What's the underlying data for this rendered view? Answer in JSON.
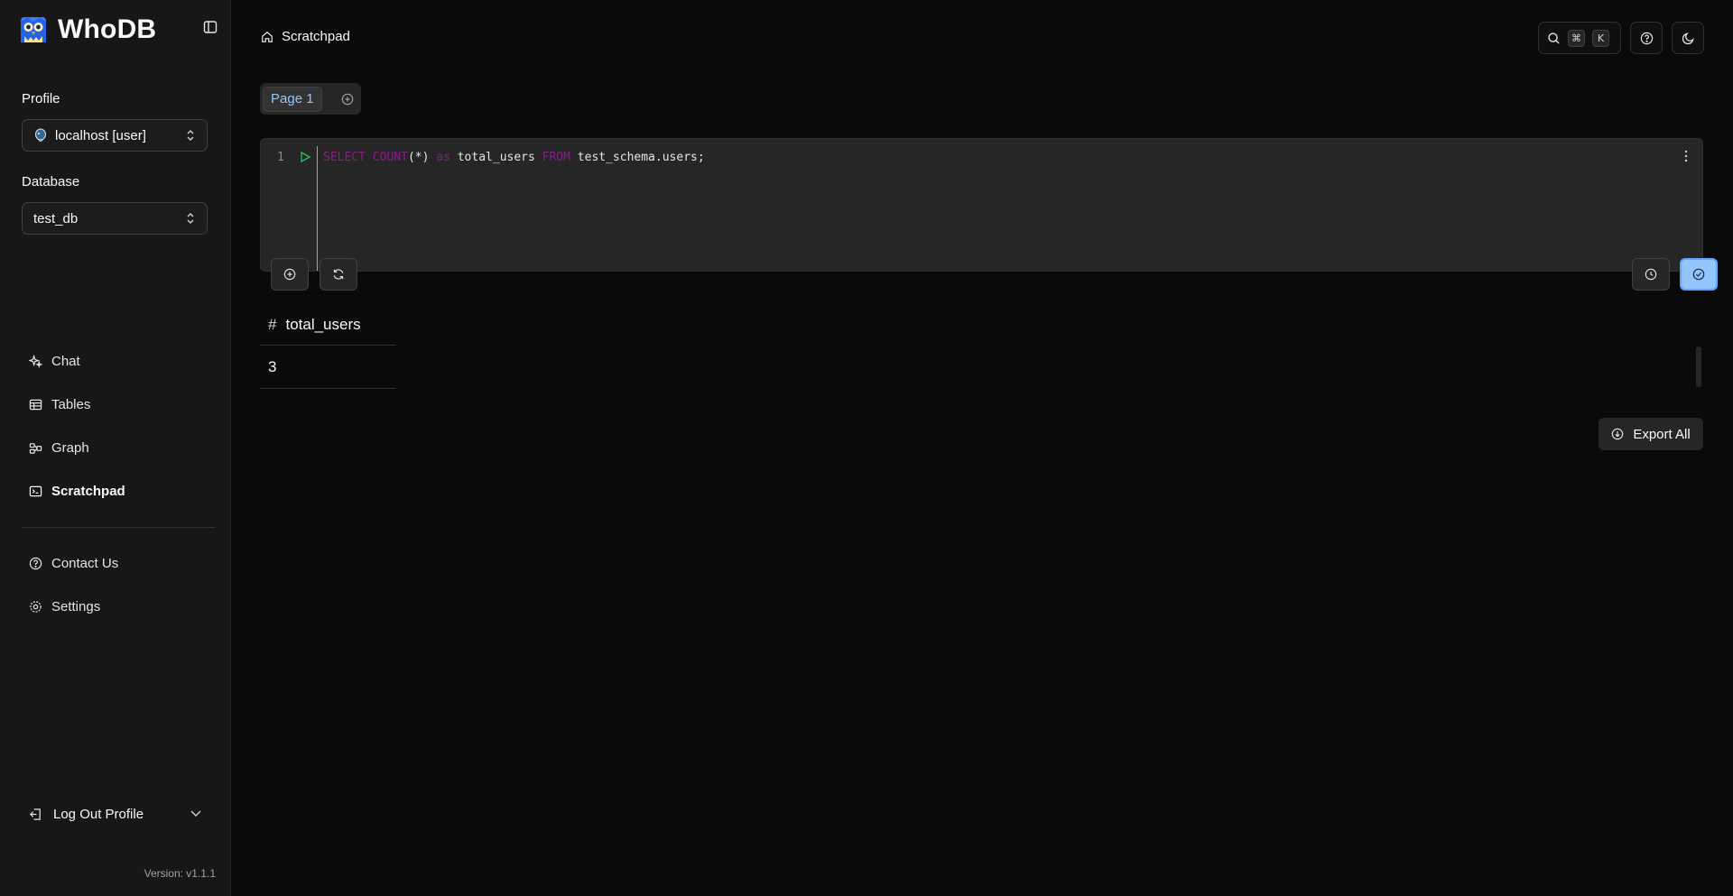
{
  "app": {
    "name": "WhoDB",
    "version": "Version: v1.1.1"
  },
  "sidebar": {
    "profile_label": "Profile",
    "profile_value": "localhost [user]",
    "database_label": "Database",
    "database_value": "test_db",
    "nav": [
      {
        "label": "Chat",
        "icon": "sparkles-icon"
      },
      {
        "label": "Tables",
        "icon": "table-icon"
      },
      {
        "label": "Graph",
        "icon": "graph-icon"
      },
      {
        "label": "Scratchpad",
        "icon": "terminal-icon",
        "active": true
      }
    ],
    "secondary": [
      {
        "label": "Contact Us",
        "icon": "help-circle-icon"
      },
      {
        "label": "Settings",
        "icon": "gear-icon"
      }
    ],
    "logout_label": "Log Out Profile"
  },
  "header": {
    "breadcrumb": "Scratchpad",
    "shortcut_keys": [
      "⌘",
      "K"
    ]
  },
  "scratchpad": {
    "tabs": [
      {
        "label": "Page 1",
        "selected": true
      }
    ],
    "editor": {
      "line_number": "1",
      "tokens": [
        {
          "text": "SELECT",
          "type": "keyword"
        },
        {
          "text": " ",
          "type": "plain"
        },
        {
          "text": "COUNT",
          "type": "keyword"
        },
        {
          "text": "(*) ",
          "type": "plain"
        },
        {
          "text": "as",
          "type": "keyword"
        },
        {
          "text": " total_users ",
          "type": "plain"
        },
        {
          "text": "FROM",
          "type": "keyword"
        },
        {
          "text": " test_schema.users;",
          "type": "plain"
        }
      ]
    },
    "results": {
      "columns": [
        "total_users"
      ],
      "column_marker": "#",
      "rows": [
        [
          "3"
        ]
      ]
    },
    "export_label": "Export All"
  },
  "colors": {
    "background": "#0a0a0a",
    "sidebar": "#171717",
    "accent": "#93c5fd",
    "keyword": "#a21caf",
    "run": "#22c55e"
  }
}
